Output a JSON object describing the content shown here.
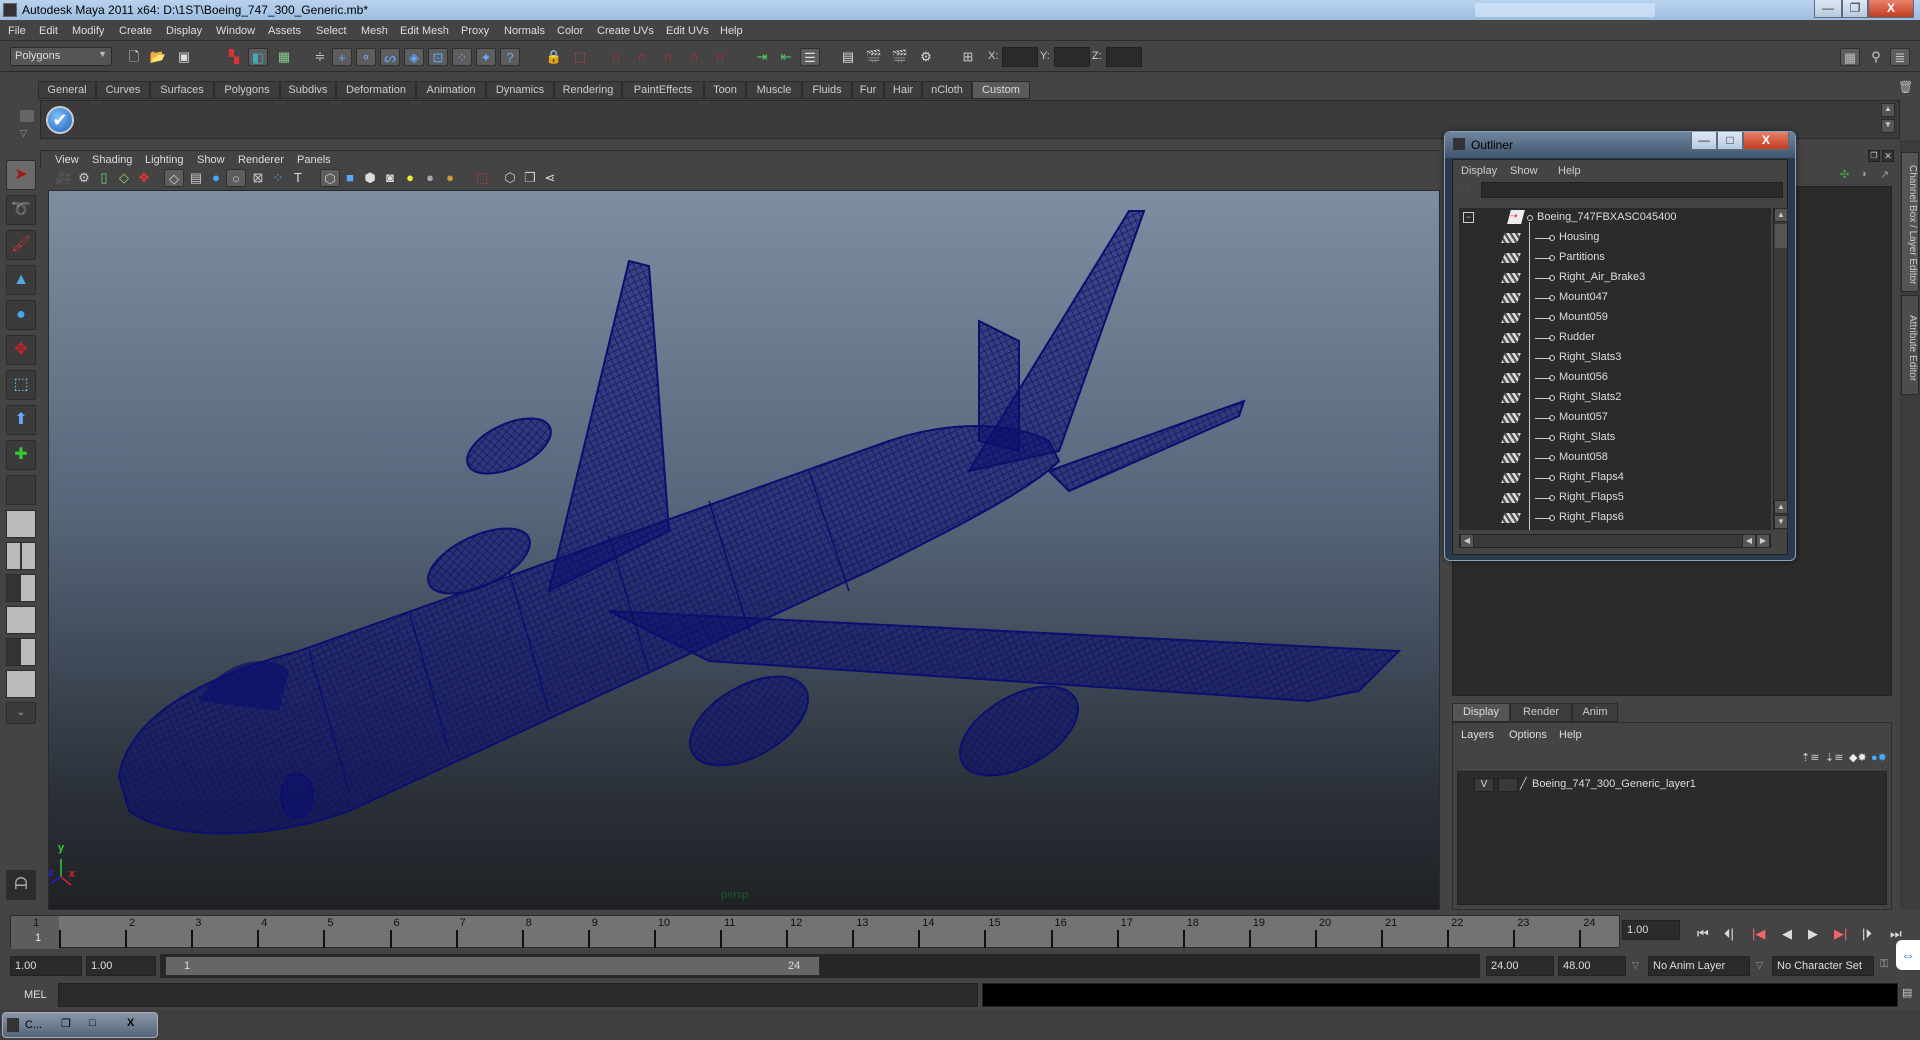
{
  "window": {
    "title": "Autodesk Maya 2011 x64: D:\\1ST\\Boeing_747_300_Generic.mb*",
    "min_label": "—",
    "restore_label": "❐",
    "close_label": "X"
  },
  "menubar": [
    "File",
    "Edit",
    "Modify",
    "Create",
    "Display",
    "Window",
    "Assets",
    "Select",
    "Mesh",
    "Edit Mesh",
    "Proxy",
    "Normals",
    "Color",
    "Create UVs",
    "Edit UVs",
    "Help"
  ],
  "statusline": {
    "menu_set": "Polygons",
    "x_label": "X:",
    "y_label": "Y:",
    "z_label": "Z:",
    "x_value": "",
    "y_value": "",
    "z_value": ""
  },
  "shelf": {
    "tabs": [
      "General",
      "Curves",
      "Surfaces",
      "Polygons",
      "Subdivs",
      "Deformation",
      "Animation",
      "Dynamics",
      "Rendering",
      "PaintEffects",
      "Toon",
      "Muscle",
      "Fluids",
      "Fur",
      "Hair",
      "nCloth",
      "Custom"
    ],
    "active_tab": "Custom"
  },
  "viewport": {
    "menu": [
      "View",
      "Shading",
      "Lighting",
      "Show",
      "Renderer",
      "Panels"
    ],
    "camera_label": "persp",
    "axis": {
      "x": "x",
      "y": "y",
      "z": "z"
    },
    "wire_color": "#0b0f6e"
  },
  "outliner": {
    "title": "Outliner",
    "menu": [
      "Display",
      "Show",
      "Help"
    ],
    "filter_value": "",
    "root": "Boeing_747FBXASC045400",
    "children": [
      "Housing",
      "Partitions",
      "Right_Air_Brake3",
      "Mount047",
      "Mount059",
      "Rudder",
      "Right_Slats3",
      "Mount056",
      "Right_Slats2",
      "Mount057",
      "Right_Slats",
      "Mount058",
      "Right_Flaps4",
      "Right_Flaps5",
      "Right_Flaps6"
    ]
  },
  "layer_editor": {
    "tabs": [
      "Display",
      "Render",
      "Anim"
    ],
    "active_tab": "Display",
    "menu": [
      "Layers",
      "Options",
      "Help"
    ],
    "layers": [
      {
        "visible": "V",
        "playback": "",
        "name": "Boeing_747_300_Generic_layer1"
      }
    ]
  },
  "side_tabs": [
    "Channel Box / Layer Editor",
    "Attribute Editor"
  ],
  "timeline": {
    "ticks": [
      "1",
      "2",
      "3",
      "4",
      "5",
      "6",
      "7",
      "8",
      "9",
      "10",
      "11",
      "12",
      "13",
      "14",
      "15",
      "16",
      "17",
      "18",
      "19",
      "20",
      "21",
      "22",
      "23",
      "24"
    ],
    "current_frame_marker": "1",
    "current_time": "1.00"
  },
  "range": {
    "start_time": "1.00",
    "playback_start": "1.00",
    "range_start": "1",
    "range_end": "24",
    "playback_end": "24.00",
    "end_time": "48.00",
    "anim_layer": "No Anim Layer",
    "character_set": "No Character Set"
  },
  "commandline": {
    "label": "MEL",
    "value": "",
    "result": ""
  },
  "taskbar": {
    "label": "C..."
  }
}
